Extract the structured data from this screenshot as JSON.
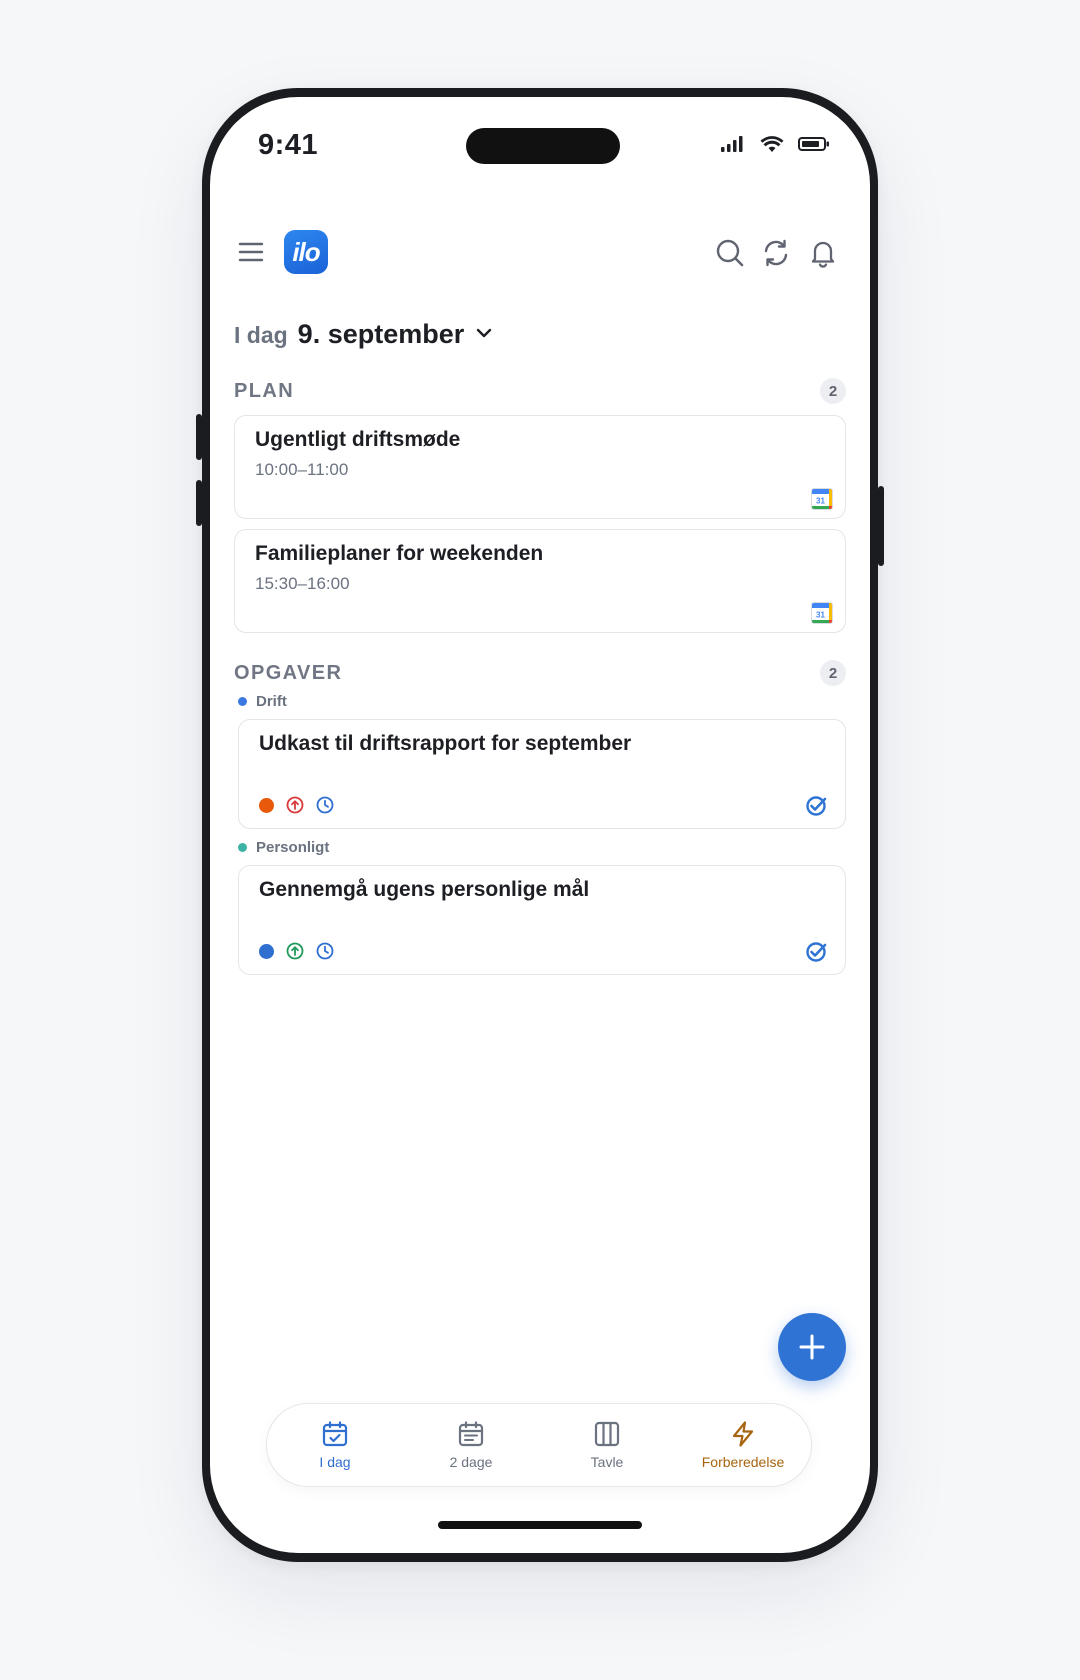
{
  "status_bar": {
    "time": "9:41"
  },
  "header": {
    "logo_text": "ilo",
    "menu_icon": "hamburger-icon",
    "actions": [
      "search-icon",
      "sync-icon",
      "bell-icon"
    ]
  },
  "date": {
    "prefix": "I dag",
    "title": "9. september"
  },
  "plan": {
    "title": "PLAN",
    "count": "2",
    "items": [
      {
        "title": "Ugentligt driftsmøde",
        "time": "10:00–11:00",
        "source_icon": "google-calendar-icon"
      },
      {
        "title": "Familieplaner for weekenden",
        "time": "15:30–16:00",
        "source_icon": "google-calendar-icon"
      }
    ]
  },
  "tasks": {
    "title": "OPGAVER",
    "count": "2",
    "groups": [
      {
        "label": "Drift",
        "color": "#3b78e0",
        "task": {
          "title": "Udkast til driftsrapport for september",
          "status_color": "#e8590c",
          "priority_color": "#d93a3a",
          "clock_color": "#2f6fd0"
        }
      },
      {
        "label": "Personligt",
        "color": "#3bb3a5",
        "task": {
          "title": "Gennemgå ugens personlige mål",
          "status_color": "#2f6fd0",
          "priority_color": "#1f9a5a",
          "clock_color": "#2f6fd0"
        }
      }
    ]
  },
  "fab": {
    "icon": "plus-icon"
  },
  "tabbar": {
    "tabs": [
      {
        "label": "I dag",
        "icon": "calendar-check-icon",
        "color": "#2f6fd0"
      },
      {
        "label": "2 dage",
        "icon": "calendar-list-icon",
        "color": "#6b7280"
      },
      {
        "label": "Tavle",
        "icon": "board-columns-icon",
        "color": "#6b7280"
      },
      {
        "label": "Forberedelse",
        "icon": "lightning-icon",
        "color": "#a8650f"
      }
    ]
  },
  "colors": {
    "accent": "#2f74d4",
    "text": "#1d1f24",
    "muted": "#6b7280"
  }
}
